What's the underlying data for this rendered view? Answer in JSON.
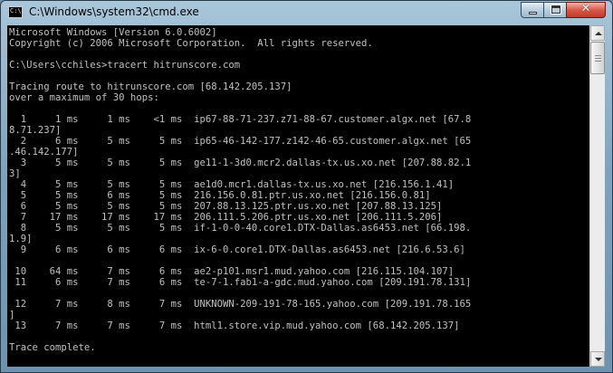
{
  "window": {
    "title": "C:\\Windows\\system32\\cmd.exe",
    "icon_text": "C:\\",
    "close_glyph": "✕"
  },
  "console": {
    "text": "Microsoft Windows [Version 6.0.6002]\nCopyright (c) 2006 Microsoft Corporation.  All rights reserved.\n\nC:\\Users\\cchiles>tracert hitrunscore.com\n\nTracing route to hitrunscore.com [68.142.205.137]\nover a maximum of 30 hops:\n\n  1     1 ms     1 ms    <1 ms  ip67-88-71-237.z71-88-67.customer.algx.net [67.8\n8.71.237]\n  2     6 ms     5 ms     5 ms  ip65-46-142-177.z142-46-65.customer.algx.net [65\n.46.142.177]\n  3     5 ms     5 ms     5 ms  ge11-1-3d0.mcr2.dallas-tx.us.xo.net [207.88.82.1\n3]\n  4     5 ms     5 ms     5 ms  ae1d0.mcr1.dallas-tx.us.xo.net [216.156.1.41]\n  5     5 ms     6 ms     5 ms  216.156.0.81.ptr.us.xo.net [216.156.0.81]\n  6     5 ms     5 ms     5 ms  207.88.13.125.ptr.us.xo.net [207.88.13.125]\n  7    17 ms    17 ms    17 ms  206.111.5.206.ptr.us.xo.net [206.111.5.206]\n  8     5 ms     5 ms     5 ms  if-1-0-0-40.core1.DTX-Dallas.as6453.net [66.198.\n1.9]\n  9     6 ms     6 ms     6 ms  ix-6-0.core1.DTX-Dallas.as6453.net [216.6.53.6]\n\n 10    64 ms     7 ms     6 ms  ae2-p101.msr1.mud.yahoo.com [216.115.104.107]\n 11     6 ms     7 ms     6 ms  te-7-1.fab1-a-gdc.mud.yahoo.com [209.191.78.131]\n\n 12     7 ms     8 ms     7 ms  UNKNOWN-209-191-78-165.yahoo.com [209.191.78.165\n]\n 13     7 ms     7 ms     7 ms  html1.store.vip.mud.yahoo.com [68.142.205.137]\n\nTrace complete.\n"
  }
}
